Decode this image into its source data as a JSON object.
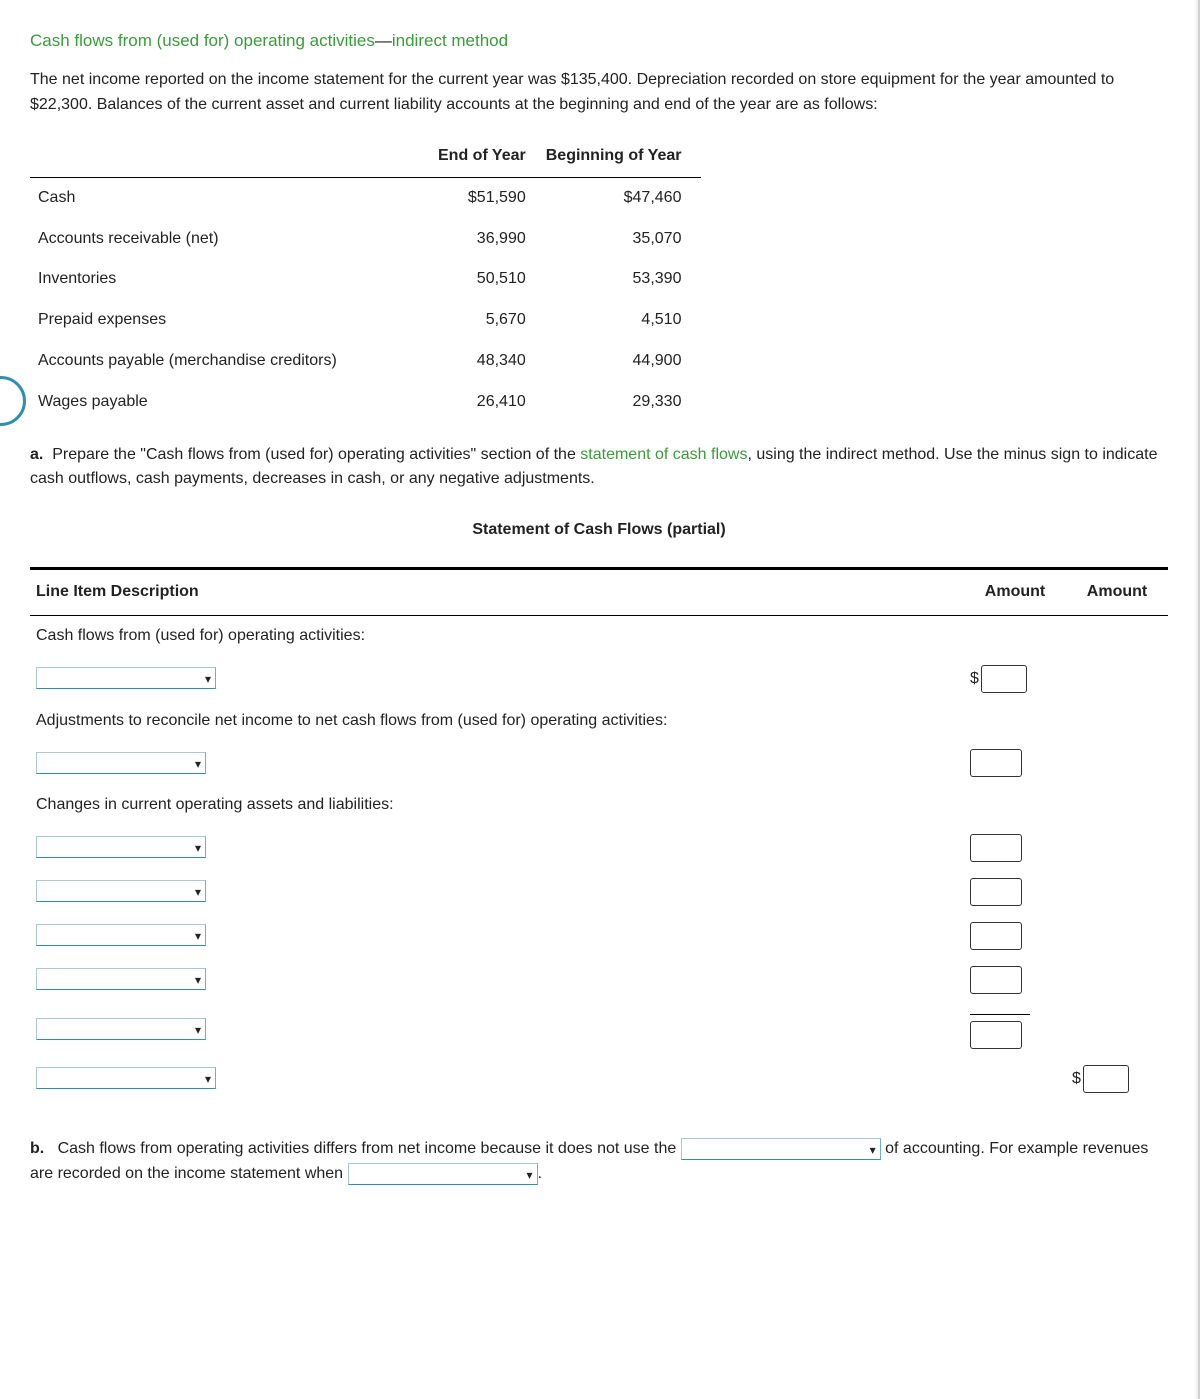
{
  "title_green": "Cash flows from (used for) operating activities",
  "title_dash": "—",
  "title_suffix": "indirect method",
  "intro": "The net income reported on the income statement for the current year was $135,400. Depreciation recorded on store equipment for the year amounted to $22,300. Balances of the current asset and current liability accounts at the beginning and end of the year are as follows:",
  "balances": {
    "cols": [
      "End of Year",
      "Beginning of Year"
    ],
    "rows": [
      {
        "label": "Cash",
        "end": "$51,590",
        "beg": "$47,460"
      },
      {
        "label": "Accounts receivable (net)",
        "end": "36,990",
        "beg": "35,070"
      },
      {
        "label": "Inventories",
        "end": "50,510",
        "beg": "53,390"
      },
      {
        "label": "Prepaid expenses",
        "end": "5,670",
        "beg": "4,510"
      },
      {
        "label": "Accounts payable (merchandise creditors)",
        "end": "48,340",
        "beg": "44,900"
      },
      {
        "label": "Wages payable",
        "end": "26,410",
        "beg": "29,330"
      }
    ]
  },
  "part_a": {
    "label": "a.",
    "text_before": "Prepare the \"Cash flows from (used for) operating activities\" section of the ",
    "link": "statement of cash flows",
    "text_after": ", using the indirect method. Use the minus sign to indicate cash outflows, cash payments, decreases in cash, or any negative adjustments."
  },
  "stmt_title": "Statement of Cash Flows (partial)",
  "cf_headers": {
    "c1": "Line Item Description",
    "c2": "Amount",
    "c3": "Amount"
  },
  "cf_lines": {
    "l1": "Cash flows from (used for) operating activities:",
    "l2": "Adjustments to reconcile net income to net cash flows from (used for) operating activities:",
    "l3": "Changes in current operating assets and liabilities:"
  },
  "dollar": "$",
  "part_b": {
    "label": "b.",
    "t1": "Cash flows from operating activities differs from net income because it does not use the ",
    "t2": " of accounting. For example revenues are recorded on the income statement when ",
    "period": "."
  }
}
